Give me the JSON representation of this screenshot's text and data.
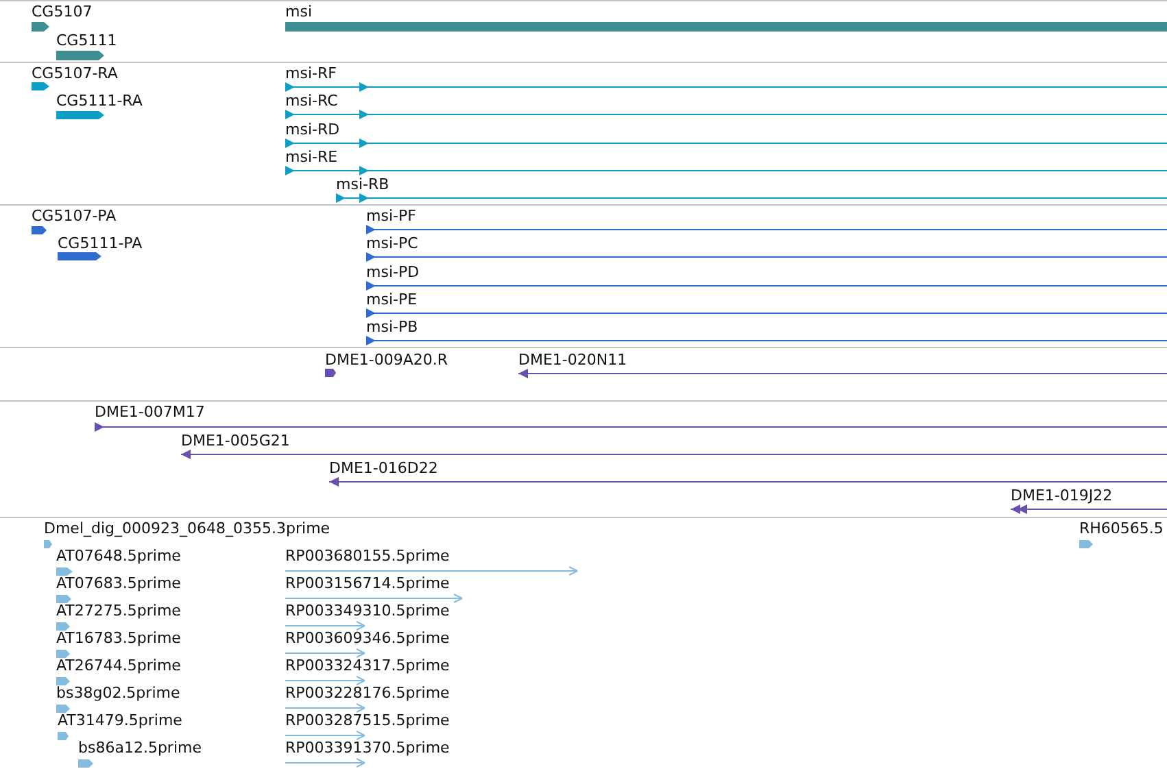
{
  "tracks": [
    {
      "kind": "gene",
      "color": "#3f8f92",
      "features": [
        {
          "label": "CG5107",
          "reverse": false
        },
        {
          "label": "CG5111",
          "reverse": false
        },
        {
          "label": "msi",
          "reverse": false
        }
      ]
    },
    {
      "kind": "transcript",
      "color": "#0ba0c4",
      "features": [
        {
          "label": "CG5107-RA",
          "reverse": false
        },
        {
          "label": "CG5111-RA",
          "reverse": false
        },
        {
          "label": "msi-RF",
          "reverse": false
        },
        {
          "label": "msi-RC",
          "reverse": false
        },
        {
          "label": "msi-RD",
          "reverse": false
        },
        {
          "label": "msi-RE",
          "reverse": false
        },
        {
          "label": "msi-RB",
          "reverse": false
        }
      ]
    },
    {
      "kind": "protein",
      "color": "#2f6bd0",
      "features": [
        {
          "label": "CG5107-PA",
          "reverse": false
        },
        {
          "label": "CG5111-PA",
          "reverse": false
        },
        {
          "label": "msi-PF",
          "reverse": false
        },
        {
          "label": "msi-PC",
          "reverse": false
        },
        {
          "label": "msi-PD",
          "reverse": false
        },
        {
          "label": "msi-PE",
          "reverse": false
        },
        {
          "label": "msi-PB",
          "reverse": false
        }
      ]
    },
    {
      "kind": "clone",
      "color": "#6a4fae",
      "features": [
        {
          "label": "DME1-009A20.R",
          "reverse": false
        },
        {
          "label": "DME1-020N11",
          "reverse": true
        }
      ]
    },
    {
      "kind": "clone",
      "color": "#6a4fae",
      "features": [
        {
          "label": "DME1-007M17",
          "reverse": false
        },
        {
          "label": "DME1-005G21",
          "reverse": true
        },
        {
          "label": "DME1-016D22",
          "reverse": true
        },
        {
          "label": "DME1-019J22",
          "reverse": true
        }
      ]
    },
    {
      "kind": "est",
      "color": "#86bbe0",
      "features": [
        {
          "label": "Dmel_dig_000923_0648_0355.3prime",
          "reverse": false
        },
        {
          "label": "AT07648.5prime",
          "reverse": false
        },
        {
          "label": "AT07683.5prime",
          "reverse": false
        },
        {
          "label": "AT27275.5prime",
          "reverse": false
        },
        {
          "label": "AT16783.5prime",
          "reverse": false
        },
        {
          "label": "AT26744.5prime",
          "reverse": false
        },
        {
          "label": "bs38g02.5prime",
          "reverse": false
        },
        {
          "label": "AT31479.5prime",
          "reverse": false
        },
        {
          "label": "bs86a12.5prime",
          "reverse": false
        },
        {
          "label": "RP003680155.5prime",
          "reverse": false
        },
        {
          "label": "RP003156714.5prime",
          "reverse": false
        },
        {
          "label": "RP003349310.5prime",
          "reverse": false
        },
        {
          "label": "RP003609346.5prime",
          "reverse": false
        },
        {
          "label": "RP003324317.5prime",
          "reverse": false
        },
        {
          "label": "RP003228176.5prime",
          "reverse": false
        },
        {
          "label": "RP003287515.5prime",
          "reverse": false
        },
        {
          "label": "RP003391370.5prime",
          "reverse": false
        },
        {
          "label": "RH60565.5",
          "reverse": false
        }
      ]
    }
  ]
}
